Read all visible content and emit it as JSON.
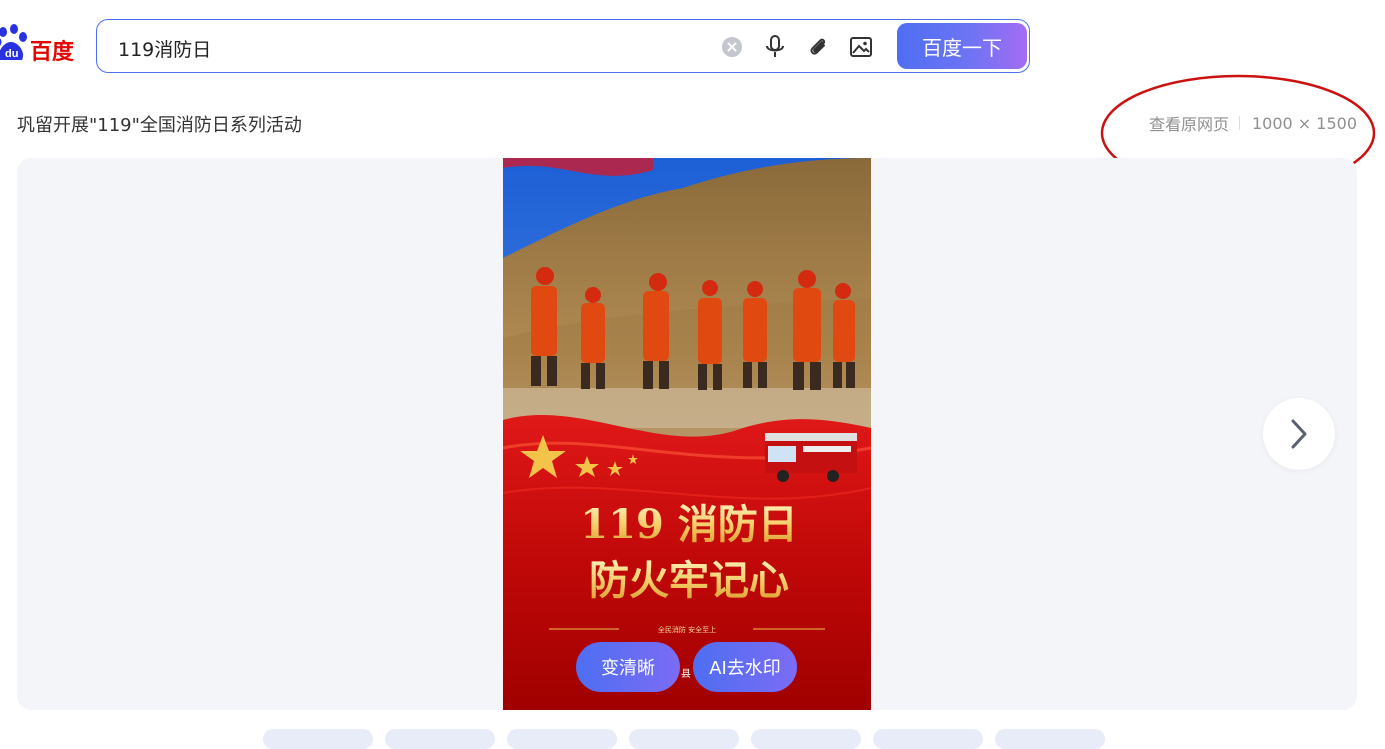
{
  "logo": {
    "text": "百度",
    "color": "#e10602"
  },
  "search": {
    "query": "119消防日",
    "button_label": "百度一下",
    "accent": "#4e6ef2"
  },
  "result": {
    "title": "巩留开展\"119\"全国消防日系列活动",
    "view_source_label": "查看原网页",
    "dimensions": "1000 × 1500"
  },
  "poster": {
    "headline_1": "119 消防日",
    "headline_2": "防火牢记心",
    "tagline": "全民消防   安全至上",
    "footer_char": "县"
  },
  "actions": {
    "enhance_label": "变清晰",
    "remove_watermark_label": "AI去水印"
  },
  "icons": [
    "clear-icon",
    "microphone-icon",
    "paperclip-icon",
    "image-search-icon",
    "chevron-right-icon"
  ],
  "annotation_color": "#cc1111"
}
